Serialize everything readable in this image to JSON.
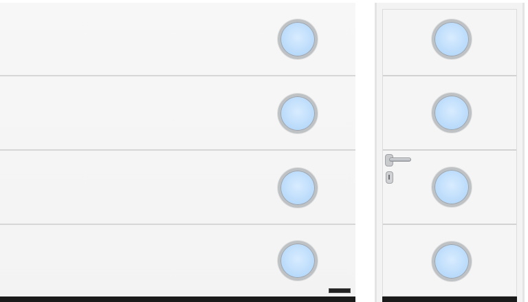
{
  "scene": {
    "garage_door": {
      "panel_count": 4,
      "porthole_window_count": 4,
      "color": "#f5f5f5",
      "window_glass_color": "#bcdcfb",
      "window_frame_color": "#bfc2c5"
    },
    "side_door": {
      "panel_count": 4,
      "porthole_window_count": 4,
      "has_handle": true,
      "has_keyhole": true
    }
  }
}
